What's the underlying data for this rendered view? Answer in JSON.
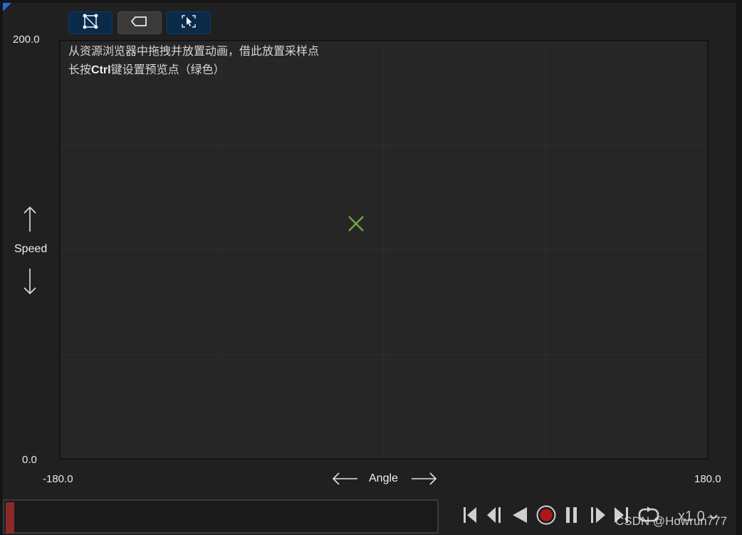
{
  "colors": {
    "accent_blue": "#1f6fd6",
    "sample_point": "#6fa83a",
    "timeline_progress": "#8c2a2a",
    "record_red": "#b01818"
  },
  "toolbar": {
    "buttons": [
      {
        "icon": "grid-nodes-icon"
      },
      {
        "icon": "tag-shape-icon"
      },
      {
        "icon": "select-cursor-icon"
      }
    ]
  },
  "hints": {
    "line1": "从资源浏览器中拖拽并放置动画，借此放置采样点",
    "line2_prefix": "长按",
    "line2_key": "Ctrl",
    "line2_suffix": "键设置预览点（绿色）"
  },
  "axes": {
    "y_max": "200.0",
    "y_min": "0.0",
    "y_name": "Speed",
    "x_min": "-180.0",
    "x_max": "180.0",
    "x_name": "Angle"
  },
  "timeline": {
    "progress": 0.02
  },
  "playback": {
    "speed": "x1.0",
    "buttons": [
      "skip-to-start-icon",
      "step-back-icon",
      "play-reverse-icon",
      "record-icon",
      "pause-icon",
      "step-forward-icon",
      "skip-to-end-icon",
      "loop-icon"
    ]
  },
  "watermark": "CSDN @Howrun777"
}
